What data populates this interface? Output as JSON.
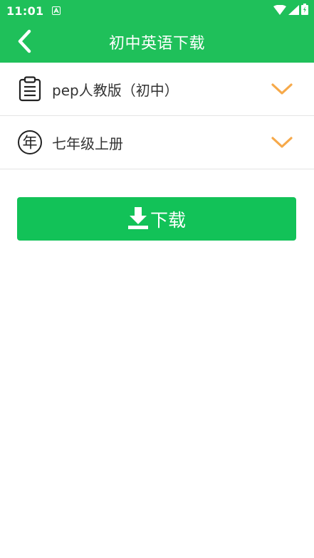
{
  "status_bar": {
    "time": "11:01",
    "notification_icon": "a-letter-icon",
    "icons": [
      "wifi-icon",
      "cell-signal-icon",
      "battery-charging-icon"
    ]
  },
  "header": {
    "title": "初中英语下载",
    "back_icon": "chevron-left-icon"
  },
  "selectors": [
    {
      "label": "pep人教版（初中）",
      "icon": "clipboard-icon"
    },
    {
      "label": "七年级上册",
      "icon": "nian-year-icon",
      "icon_text": "年"
    }
  ],
  "download": {
    "label": "下载",
    "icon": "download-icon"
  },
  "colors": {
    "brand_green": "#1fc05a",
    "button_green": "#12c258",
    "chevron_orange": "#f6a94a",
    "text_dark": "#333333"
  }
}
